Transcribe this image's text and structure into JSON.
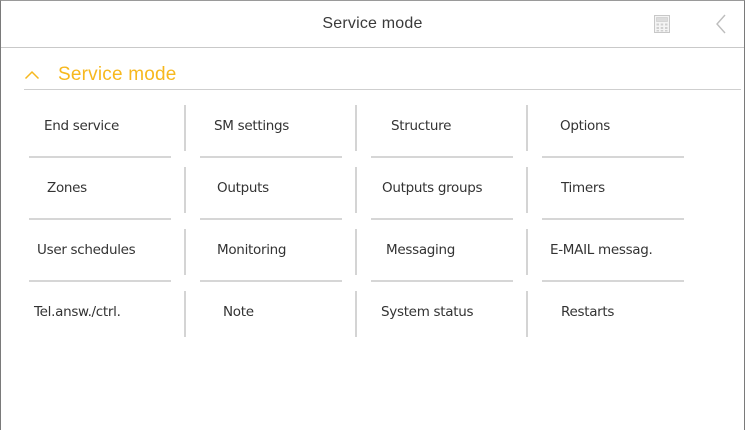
{
  "topbar": {
    "title": "Service mode",
    "calculator_icon": "calculator-icon",
    "back_icon": "chevron-left-icon"
  },
  "section": {
    "title": "Service mode",
    "state": "expanded",
    "collapse_icon": "chevron-up-icon",
    "accent_color": "#f7b81e"
  },
  "menu": {
    "rows": [
      [
        "End service",
        "SM settings",
        "Structure",
        "Options"
      ],
      [
        "Zones",
        "Outputs",
        "Outputs groups",
        "Timers"
      ],
      [
        "User schedules",
        "Monitoring",
        "Messaging",
        "E-MAIL messag."
      ],
      [
        "Tel.answ./ctrl.",
        "Note",
        "System status",
        "Restarts"
      ]
    ]
  }
}
